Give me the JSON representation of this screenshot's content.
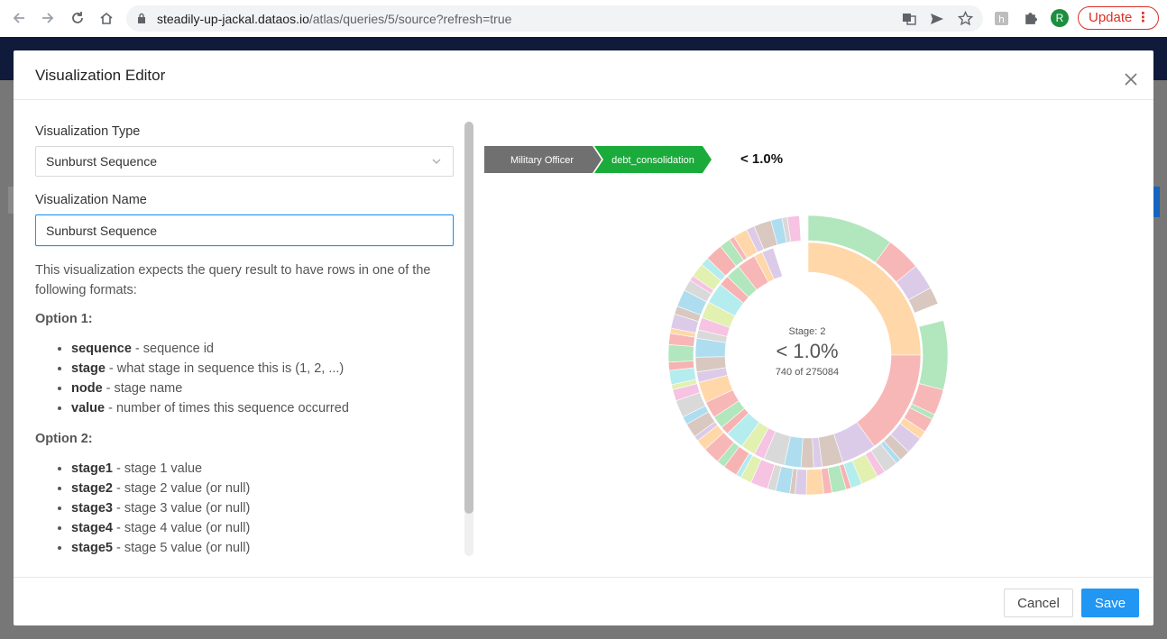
{
  "browser": {
    "url_host": "steadily-up-jackal.dataos.io",
    "url_path": "/atlas/queries/5/source?refresh=true",
    "avatar_initial": "R",
    "update_label": "Update"
  },
  "modal": {
    "title": "Visualization Editor",
    "type_label": "Visualization Type",
    "type_value": "Sunburst Sequence",
    "name_label": "Visualization Name",
    "name_value": "Sunburst Sequence",
    "description": "This visualization expects the query result to have rows in one of the following formats:",
    "option1_title": "Option 1:",
    "option1_items": [
      {
        "key": "sequence",
        "desc": " - sequence id"
      },
      {
        "key": "stage",
        "desc": " - what stage in sequence this is (1, 2, ...)"
      },
      {
        "key": "node",
        "desc": " - stage name"
      },
      {
        "key": "value",
        "desc": " - number of times this sequence occurred"
      }
    ],
    "option2_title": "Option 2:",
    "option2_items": [
      {
        "key": "stage1",
        "desc": " - stage 1 value"
      },
      {
        "key": "stage2",
        "desc": " - stage 2 value (or null)"
      },
      {
        "key": "stage3",
        "desc": " - stage 3 value (or null)"
      },
      {
        "key": "stage4",
        "desc": " - stage 4 value (or null)"
      },
      {
        "key": "stage5",
        "desc": " - stage 5 value (or null)"
      }
    ],
    "cancel_label": "Cancel",
    "save_label": "Save"
  },
  "sunburst": {
    "breadcrumbs": [
      "Military Officer",
      "debt_consolidation"
    ],
    "breadcrumb_colors": [
      "#707070",
      "#1aab3a"
    ],
    "breadcrumb_pct": "< 1.0%",
    "center_stage": "Stage: 2",
    "center_pct": "< 1.0%",
    "center_count": "740 of 275084"
  },
  "colors": {
    "accent": "#2196f3",
    "danger": "#d93025",
    "app_bar": "#101a3a"
  }
}
